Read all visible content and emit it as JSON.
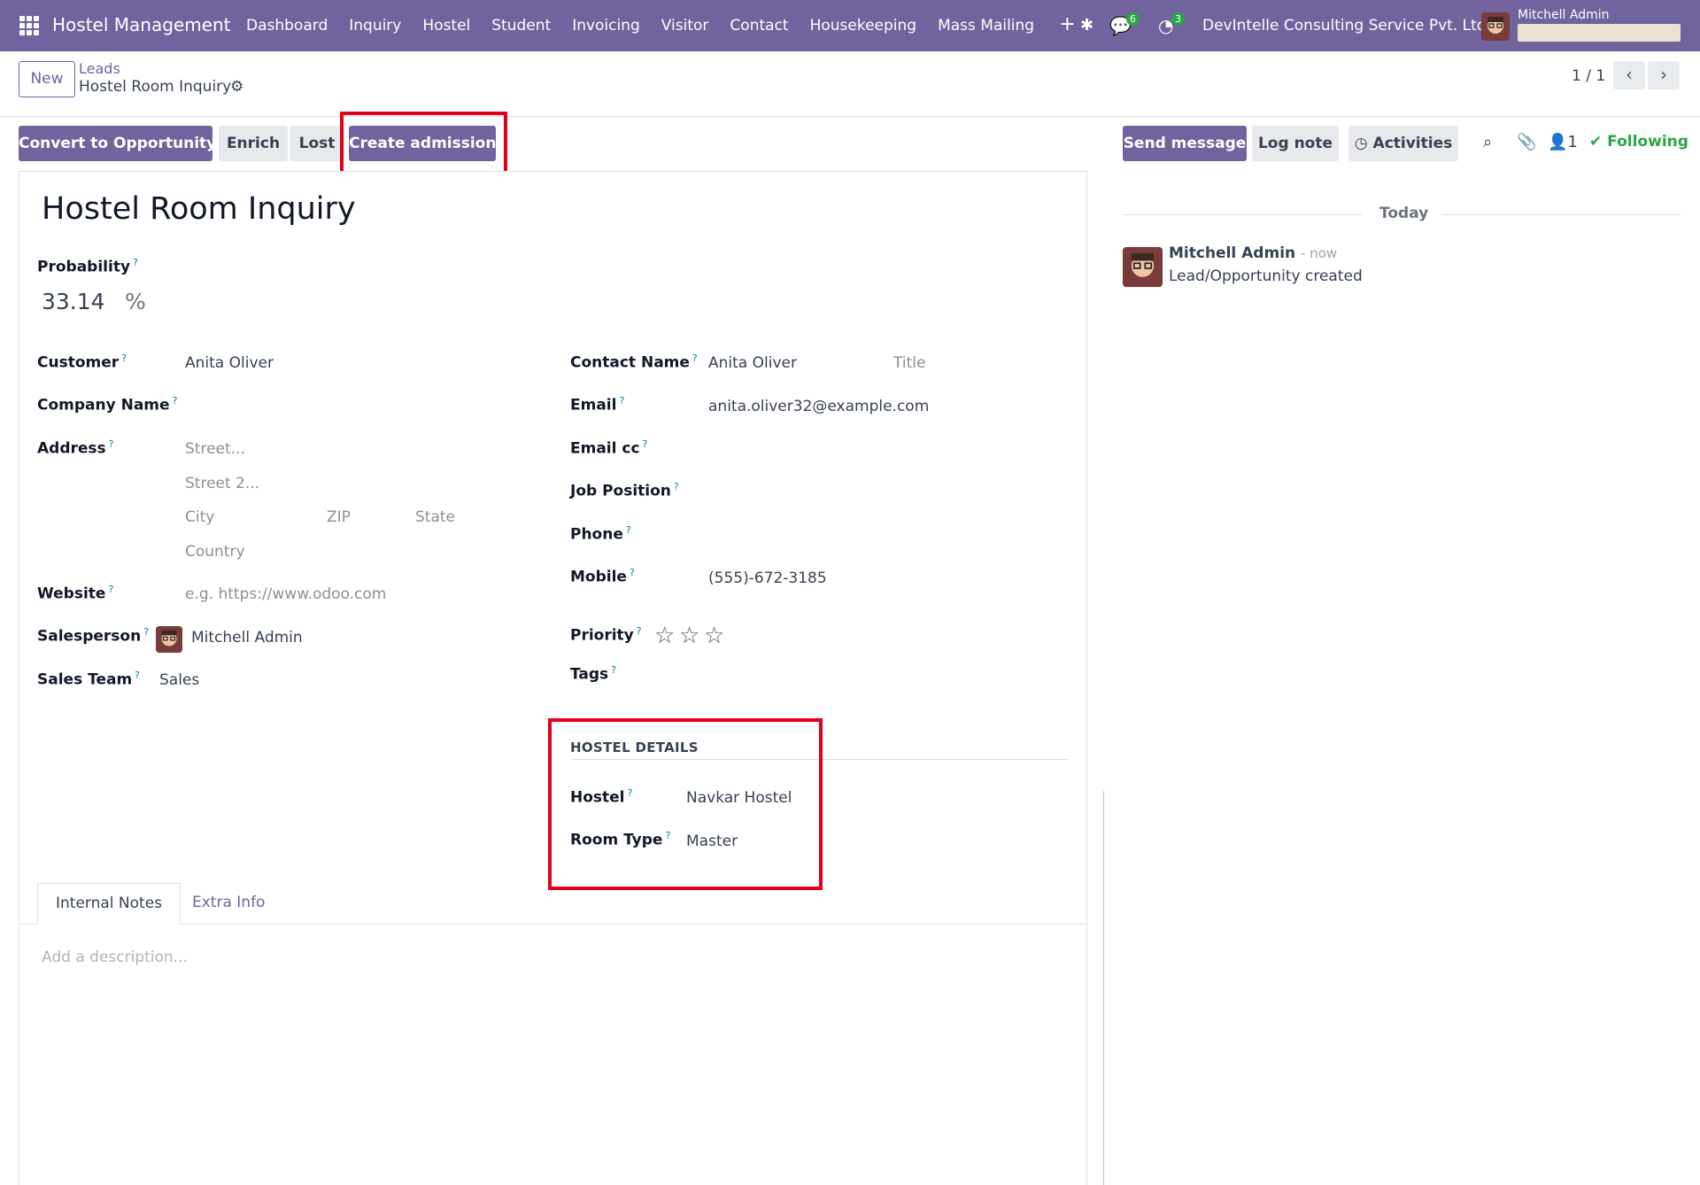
{
  "navbar": {
    "brand": "Hostel Management",
    "menu": [
      "Dashboard",
      "Inquiry",
      "Hostel",
      "Student",
      "Invoicing",
      "Visitor",
      "Contact",
      "Housekeeping",
      "Mass Mailing"
    ],
    "plus": "+",
    "messages_badge": "6",
    "activities_badge": "3",
    "company": "DevIntelle Consulting Service Pvt. Ltd",
    "user": "Mitchell Admin"
  },
  "control": {
    "new_label": "New",
    "breadcrumb_parent": "Leads",
    "breadcrumb_current": "Hostel Room Inquiry",
    "pager": "1 / 1"
  },
  "actions": {
    "convert": "Convert to Opportunity",
    "enrich": "Enrich",
    "lost": "Lost",
    "create_admission": "Create admission"
  },
  "chatter_actions": {
    "send_message": "Send message",
    "log_note": "Log note",
    "activities": "Activities",
    "followers_count": "1",
    "following": "Following"
  },
  "form": {
    "title": "Hostel Room Inquiry",
    "probability_label": "Probability",
    "probability_value": "33.14",
    "probability_unit": "%",
    "customer_label": "Customer",
    "customer_value": "Anita Oliver",
    "company_name_label": "Company Name",
    "address_label": "Address",
    "street_ph": "Street...",
    "street2_ph": "Street 2...",
    "city_ph": "City",
    "zip_ph": "ZIP",
    "state_ph": "State",
    "country_ph": "Country",
    "website_label": "Website",
    "website_ph": "e.g. https://www.odoo.com",
    "salesperson_label": "Salesperson",
    "salesperson_value": "Mitchell Admin",
    "sales_team_label": "Sales Team",
    "sales_team_value": "Sales",
    "contact_name_label": "Contact Name",
    "contact_name_value": "Anita Oliver",
    "title_ph": "Title",
    "email_label": "Email",
    "email_value": "anita.oliver32@example.com",
    "email_cc_label": "Email cc",
    "job_position_label": "Job Position",
    "phone_label": "Phone",
    "mobile_label": "Mobile",
    "mobile_value": "(555)-672-3185",
    "priority_label": "Priority",
    "priority_stars": 0,
    "tags_label": "Tags",
    "hostel_section": "HOSTEL DETAILS",
    "hostel_label": "Hostel",
    "hostel_value": "Navkar Hostel",
    "room_type_label": "Room Type",
    "room_type_value": "Master"
  },
  "tabs": {
    "internal_notes": "Internal Notes",
    "extra_info": "Extra Info",
    "description_ph": "Add a description..."
  },
  "chatter": {
    "today": "Today",
    "author": "Mitchell Admin",
    "time": "- now",
    "body": "Lead/Opportunity created"
  },
  "colors": {
    "brand": "#71639e",
    "highlight": "#e3001b",
    "following": "#28a745"
  }
}
